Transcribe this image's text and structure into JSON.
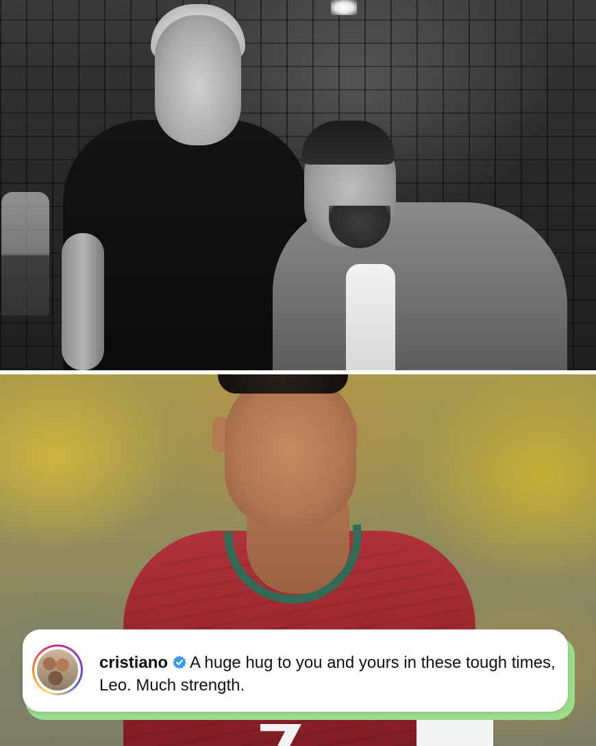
{
  "comment": {
    "username": "cristiano",
    "verified_icon": "verified-badge-icon",
    "text": "A huge hug to you and yours in these tough times, Leo. Much strength."
  },
  "colors": {
    "verified_blue": "#3897f0",
    "card_shadow_green": "#9bdc8d",
    "jersey_red": "#a0282f",
    "collar_green": "#2f6b55"
  }
}
